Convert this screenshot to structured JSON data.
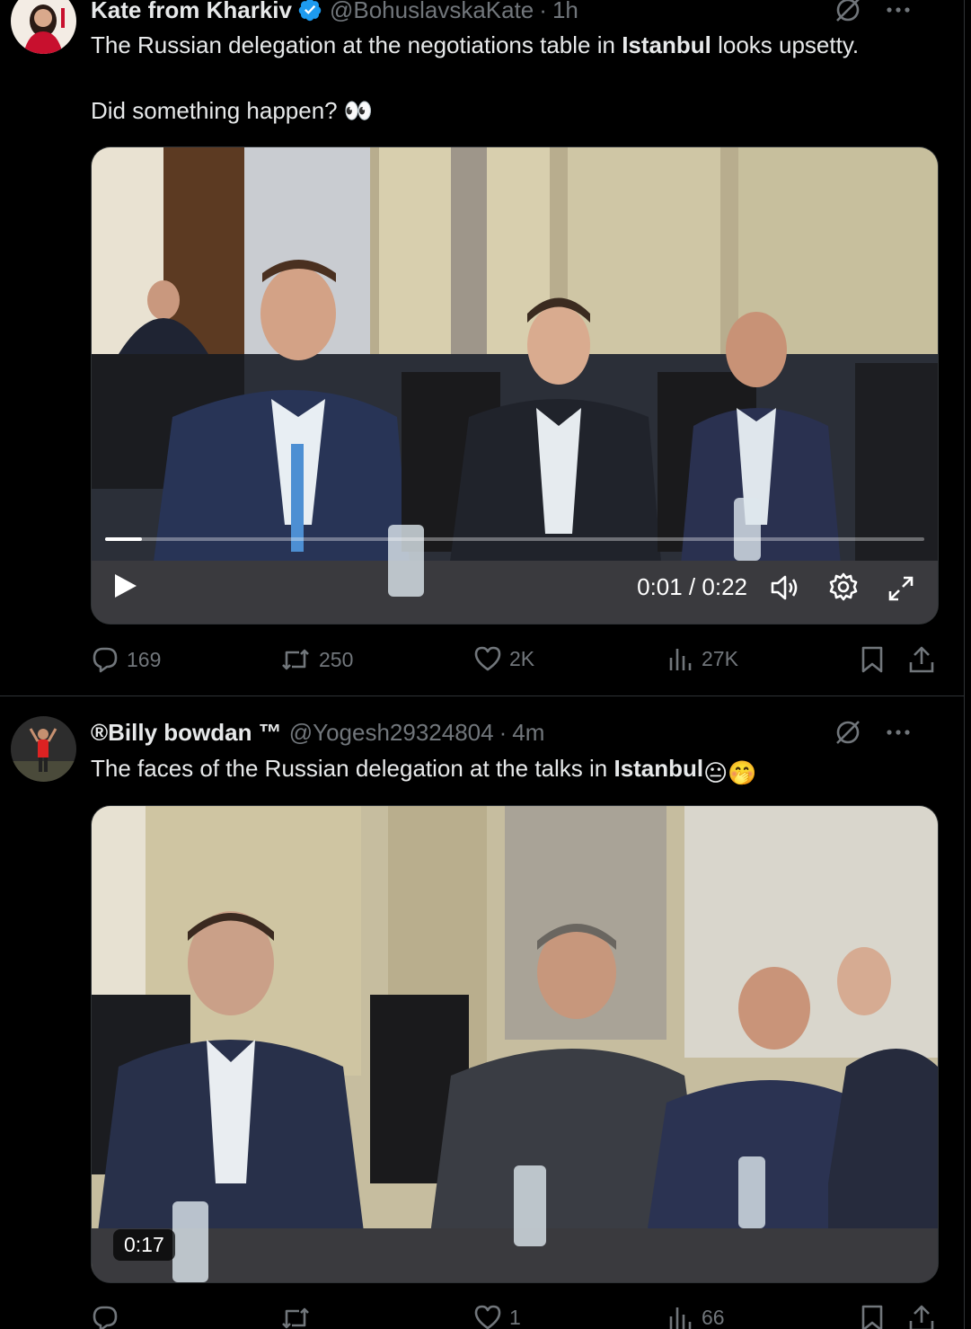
{
  "colors": {
    "background": "#000000",
    "text_primary": "#e7e9ea",
    "text_secondary": "#71767b",
    "verified_blue": "#1d9bf0",
    "divider": "#2f3336"
  },
  "tweets": [
    {
      "author_name": "Kate from Kharkiv",
      "verified": true,
      "handle": "@BohuslavskaKate",
      "separator": "·",
      "time": "1h",
      "text_segments": [
        "The Russian delegation at the negotiations table in ",
        "Istanbul",
        " looks upsetty."
      ],
      "text_line2": "Did something happen? 👀",
      "media": {
        "type": "video",
        "time_display": "0:01 / 0:22",
        "progress_fraction": 0.045
      },
      "stats": {
        "replies": "169",
        "reposts": "250",
        "likes": "2K",
        "views": "27K"
      }
    },
    {
      "author_name": "®Billy bowdan ™",
      "verified": false,
      "handle": "@Yogesh29324804",
      "separator": "·",
      "time": "4m",
      "text_segments": [
        "The faces of the Russian delegation at the talks in ",
        "Istanbul",
        "😐🤭"
      ],
      "media": {
        "type": "video",
        "duration_badge": "0:17"
      },
      "stats": {
        "replies": "",
        "reposts": "",
        "likes": "1",
        "views": "66"
      }
    }
  ],
  "icons": {
    "reply": "reply-icon",
    "repost": "repost-icon",
    "like": "like-icon",
    "views": "views-icon",
    "bookmark": "bookmark-icon",
    "share": "share-icon",
    "grok": "grok-icon",
    "more": "more-icon",
    "play": "play-icon",
    "volume": "volume-icon",
    "settings": "settings-icon",
    "fullscreen": "fullscreen-icon",
    "verified": "verified-badge-icon"
  }
}
